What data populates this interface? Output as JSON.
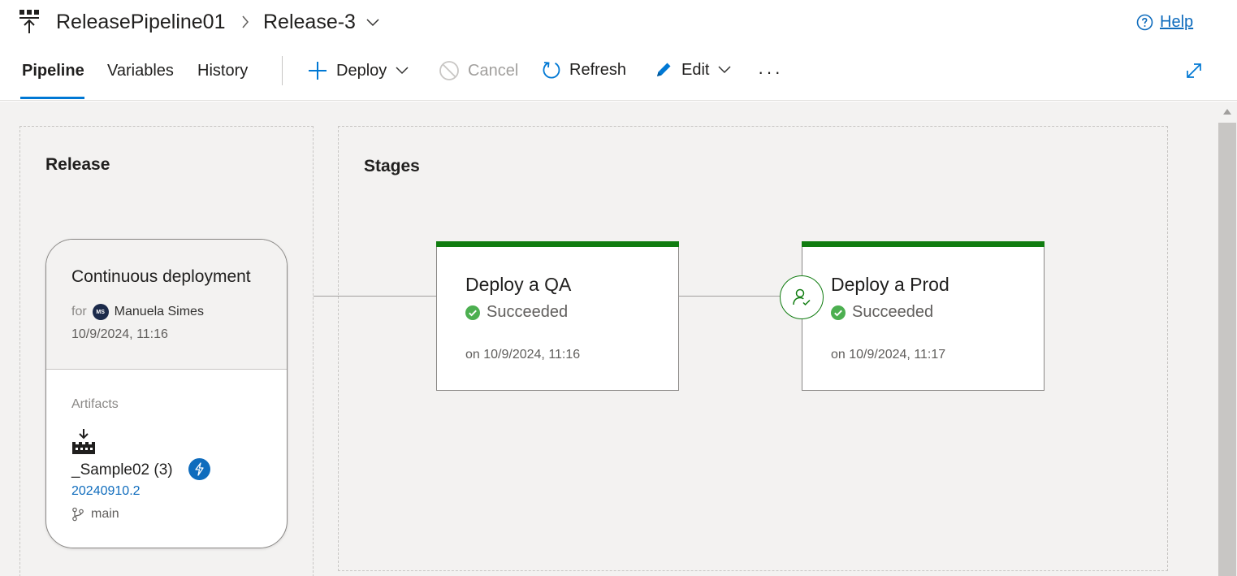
{
  "breadcrumb": {
    "pipeline_name": "ReleasePipeline01",
    "release_name": "Release-3"
  },
  "help": {
    "label": "Help"
  },
  "tabs": [
    {
      "label": "Pipeline",
      "active": true
    },
    {
      "label": "Variables",
      "active": false
    },
    {
      "label": "History",
      "active": false
    }
  ],
  "toolbar": {
    "deploy_label": "Deploy",
    "cancel_label": "Cancel",
    "refresh_label": "Refresh",
    "edit_label": "Edit",
    "more_label": "···"
  },
  "release_section": {
    "title": "Release",
    "trigger": "Continuous deployment",
    "for_label": "for",
    "user_initials": "MS",
    "user_name": "Manuela Simes",
    "date": "10/9/2024, 11:16",
    "artifacts_label": "Artifacts",
    "artifact_name": "_Sample02 (3)",
    "artifact_version": "20240910.2",
    "branch": "main"
  },
  "stages_section": {
    "title": "Stages",
    "stages": [
      {
        "name": "Deploy a QA",
        "status": "Succeeded",
        "date": "on 10/9/2024, 11:16"
      },
      {
        "name": "Deploy a Prod",
        "status": "Succeeded",
        "date": "on 10/9/2024, 11:17"
      }
    ]
  },
  "colors": {
    "accent": "#0078d4",
    "link": "#0f6cbd",
    "success": "#107c10",
    "canvas": "#f3f2f1"
  },
  "icons": {
    "logo": "release-pipeline-icon",
    "help": "question-circle-icon",
    "deploy": "plus-icon",
    "cancel": "cancel-icon",
    "refresh": "refresh-icon",
    "edit": "pencil-icon",
    "expand": "expand-icon",
    "artifact": "build-artifact-icon",
    "trigger": "lightning-icon",
    "branch": "git-branch-icon",
    "status": "check-circle-icon",
    "approval": "approver-icon"
  }
}
